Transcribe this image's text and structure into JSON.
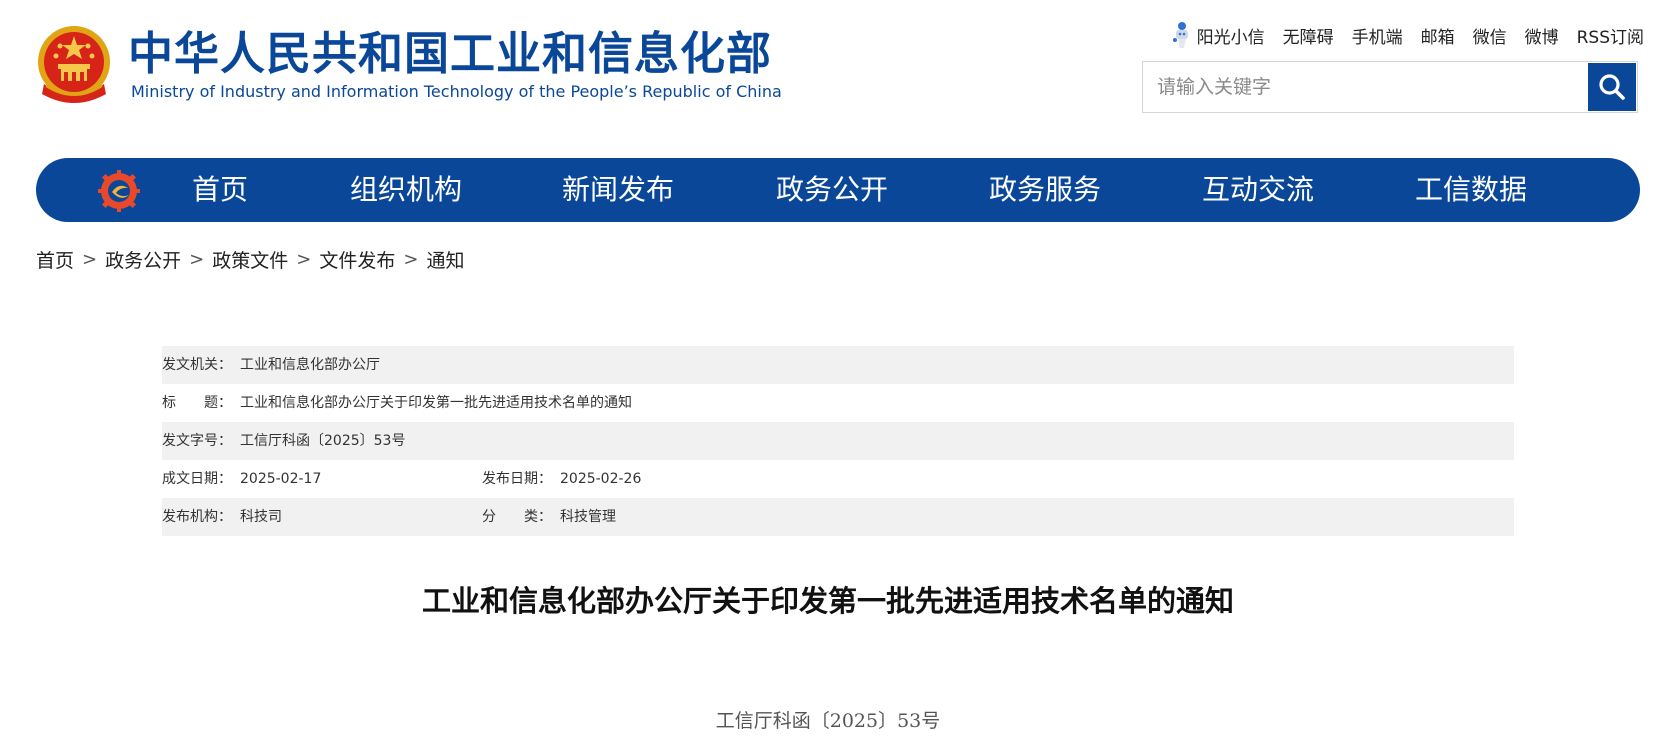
{
  "header": {
    "site_name_cn": "中华人民共和国工业和信息化部",
    "site_name_en": "Ministry of Industry and Information Technology of the People’s Republic of China",
    "emblem_icon": "national-emblem-icon",
    "top_links": [
      "阳光小信",
      "无障碍",
      "手机端",
      "邮箱",
      "微信",
      "微博",
      "RSS订阅"
    ],
    "search": {
      "placeholder": "请输入关键字",
      "icon": "search-icon"
    }
  },
  "nav": {
    "logo_icon": "miit-gear-logo-icon",
    "items": [
      "首页",
      "组织机构",
      "新闻发布",
      "政务公开",
      "政务服务",
      "互动交流",
      "工信数据"
    ]
  },
  "breadcrumb": [
    "首页",
    "政务公开",
    "政策文件",
    "文件发布",
    "通知"
  ],
  "breadcrumb_separator": ">",
  "doc_info": {
    "issuer_label": "发文机关：",
    "issuer": "工业和信息化部办公厅",
    "title_label_a": "标",
    "title_label_b": "题：",
    "title": "工业和信息化部办公厅关于印发第一批先进适用技术名单的通知",
    "doc_no_label": "发文字号：",
    "doc_no": "工信厅科函〔2025〕53号",
    "written_date_label": "成文日期：",
    "written_date": "2025-02-17",
    "publish_date_label": "发布日期：",
    "publish_date": "2025-02-26",
    "publisher_label": "发布机构：",
    "publisher": "科技司",
    "category_label_a": "分",
    "category_label_b": "类：",
    "category": "科技管理"
  },
  "article": {
    "title": "工业和信息化部办公厅关于印发第一批先进适用技术名单的通知",
    "doc_number": "工信厅科函〔2025〕53号"
  },
  "colors": {
    "brand_blue": "#0a4799",
    "row_shade": "#f1f1f1"
  }
}
